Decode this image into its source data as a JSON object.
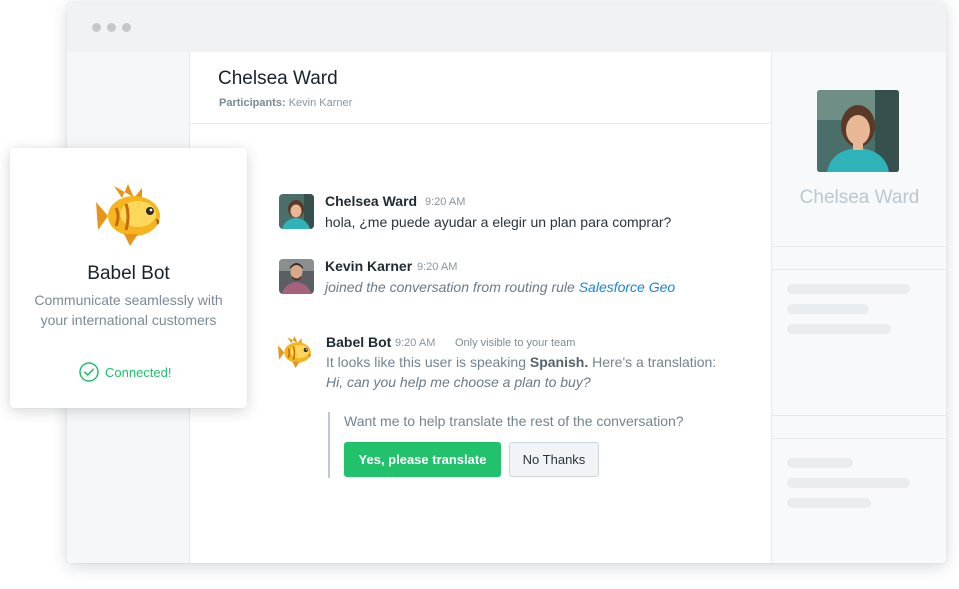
{
  "conversation": {
    "title": "Chelsea Ward",
    "participants_label": "Participants:",
    "participants_value": "Kevin Karner"
  },
  "profile": {
    "name": "Chelsea Ward"
  },
  "messages": [
    {
      "sender": "Chelsea Ward",
      "time": "9:20 AM",
      "text": "hola, ¿me puede ayudar a elegir un plan para comprar?"
    },
    {
      "sender": "Kevin Karner",
      "time": "9:20 AM",
      "text": "joined the conversation from routing rule ",
      "link": "Salesforce Geo"
    },
    {
      "sender": "Babel Bot",
      "time": "9:20 AM",
      "note": "Only visible to your team",
      "text_prefix": "It looks like this user is speaking ",
      "language": "Spanish.",
      "text_suffix": " Here's a translation:",
      "translation": "Hi, can you help me choose a plan to buy?"
    }
  ],
  "prompt": {
    "question": "Want me to help translate the rest of the conversation?",
    "yes_label": "Yes, please translate",
    "no_label": "No Thanks"
  },
  "bot_card": {
    "title": "Babel Bot",
    "desc_line1": "Communicate seamlessly with",
    "desc_line2": "your international customers",
    "status": "Connected!"
  },
  "colors": {
    "accent_green": "#21c26b",
    "link_blue": "#1b84d6",
    "profile_name": "#b9c8d2"
  },
  "icons": [
    "window-dots",
    "babel-fish-icon",
    "check-circle-icon"
  ]
}
